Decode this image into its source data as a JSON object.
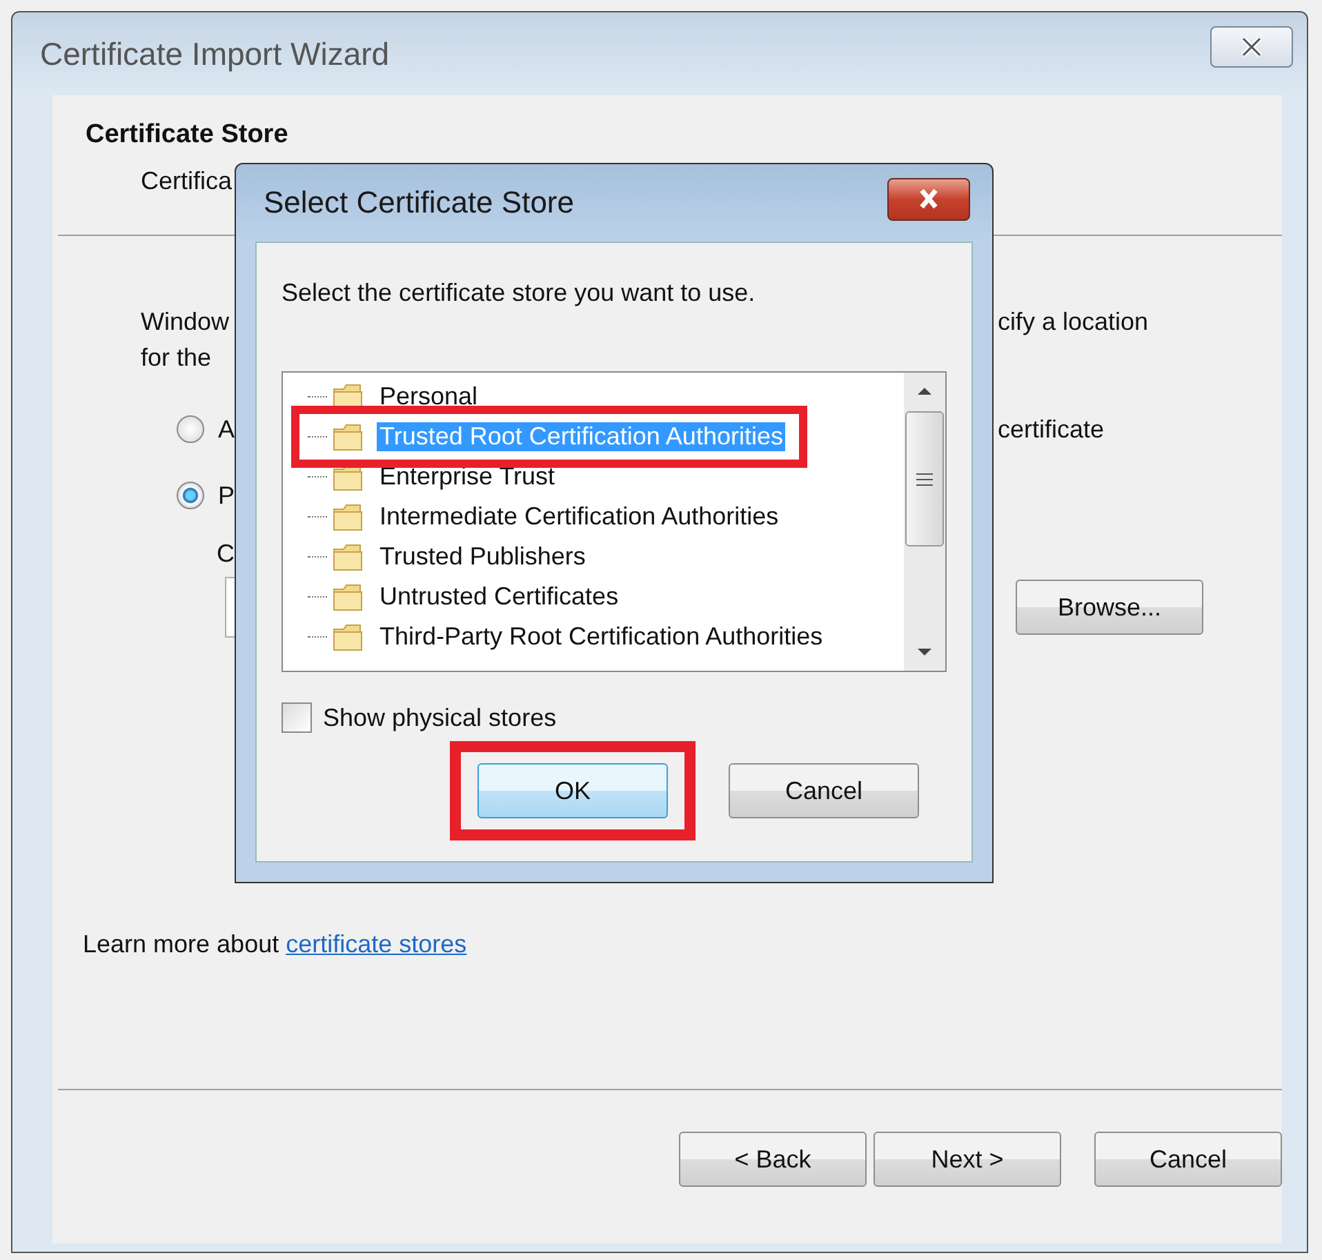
{
  "wizard": {
    "title": "Certificate Import Wizard",
    "heading": "Certificate Store",
    "subheading": "Certifica",
    "description_lines": [
      {
        "left": "Window",
        "right": "cify a location"
      },
      {
        "left": "for the"
      }
    ],
    "options": [
      {
        "label": "A",
        "trailing": "certificate",
        "selected": false
      },
      {
        "label": "P",
        "selected": true
      }
    ],
    "field_label": "C",
    "browse_button": "Browse...",
    "learn_more": "Learn more about",
    "link": "certificate stores",
    "buttons": [
      "< Back",
      "Next >",
      "Cancel"
    ]
  },
  "dialog": {
    "title": "Select Certificate Store",
    "prompt": "Select the certificate store you want to use.",
    "stores": [
      {
        "name": "Personal",
        "selected": false,
        "highlighted": false
      },
      {
        "name": "Trusted Root Certification Authorities",
        "selected": true,
        "highlighted": true
      },
      {
        "name": "Enterprise Trust",
        "selected": false,
        "highlighted": false
      },
      {
        "name": "Intermediate Certification Authorities",
        "selected": false,
        "highlighted": false
      },
      {
        "name": "Trusted Publishers",
        "selected": false,
        "highlighted": false
      },
      {
        "name": "Untrusted Certificates",
        "selected": false,
        "highlighted": false
      },
      {
        "name": "Third-Party Root Certification Authorities",
        "selected": false,
        "highlighted": false
      }
    ],
    "show_physical_stores": {
      "label": "Show physical stores",
      "checked": false
    },
    "buttons": [
      {
        "label": "OK",
        "highlighted": true
      },
      {
        "label": "Cancel",
        "highlighted": false
      }
    ]
  }
}
